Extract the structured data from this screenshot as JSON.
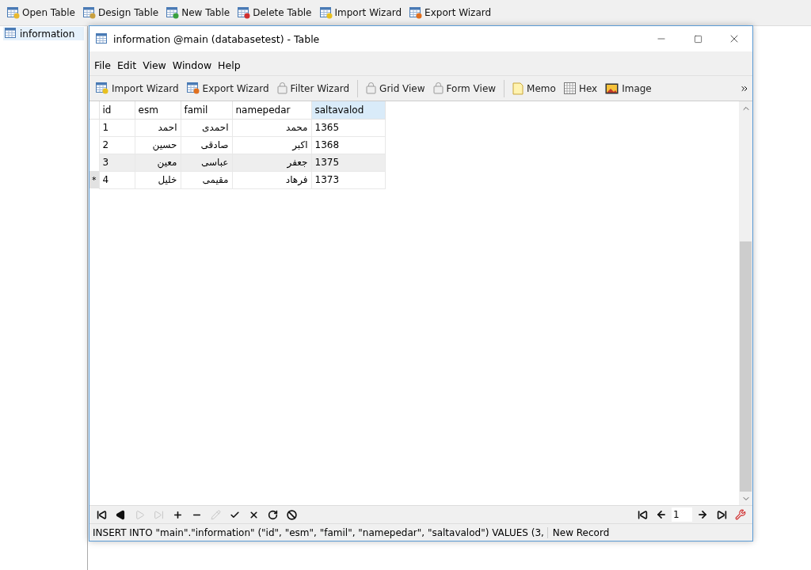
{
  "main_toolbar": [
    {
      "label": "Open Table",
      "kind": "open"
    },
    {
      "label": "Design Table",
      "kind": "design"
    },
    {
      "label": "New Table",
      "kind": "new"
    },
    {
      "label": "Delete Table",
      "kind": "delete"
    },
    {
      "label": "Import Wizard",
      "kind": "import"
    },
    {
      "label": "Export Wizard",
      "kind": "export"
    }
  ],
  "sidebar": {
    "items": [
      {
        "label": "information",
        "selected": true
      }
    ]
  },
  "window": {
    "title": "information @main (databasetest) - Table"
  },
  "menu": [
    "File",
    "Edit",
    "View",
    "Window",
    "Help"
  ],
  "toolbar": [
    {
      "label": "Import Wizard",
      "kind": "import",
      "disabled": false
    },
    {
      "label": "Export Wizard",
      "kind": "export",
      "disabled": false
    },
    {
      "label": "Filter Wizard",
      "kind": "lock",
      "disabled": false
    },
    {
      "kind": "separator"
    },
    {
      "label": "Grid View",
      "kind": "lock",
      "disabled": false
    },
    {
      "label": "Form View",
      "kind": "lock",
      "disabled": false
    },
    {
      "kind": "separator"
    },
    {
      "label": "Memo",
      "kind": "memo",
      "disabled": false
    },
    {
      "label": "Hex",
      "kind": "hex",
      "disabled": false
    },
    {
      "label": "Image",
      "kind": "image",
      "disabled": false
    }
  ],
  "table": {
    "columns": [
      {
        "label": "id",
        "selected": false
      },
      {
        "label": "esm",
        "selected": false
      },
      {
        "label": "famil",
        "selected": false
      },
      {
        "label": "namepedar",
        "selected": false
      },
      {
        "label": "saltavalod",
        "selected": true
      }
    ],
    "rows": [
      {
        "cells": [
          "1",
          "احمد",
          "احمدی",
          "محمد",
          "1365"
        ],
        "highlighted": false,
        "current": false
      },
      {
        "cells": [
          "2",
          "حسین",
          "صادقی",
          "اکبر",
          "1368"
        ],
        "highlighted": false,
        "current": false
      },
      {
        "cells": [
          "3",
          "معین",
          "عباسی",
          "جعفر",
          "1375"
        ],
        "highlighted": true,
        "current": false
      },
      {
        "cells": [
          "4",
          "خلیل",
          "مقیمی",
          "فرهاد",
          "1373"
        ],
        "highlighted": false,
        "current": true,
        "marker": "*"
      }
    ]
  },
  "nav_buttons": [
    {
      "kind": "first",
      "disabled": false
    },
    {
      "kind": "prev",
      "disabled": false
    },
    {
      "kind": "next",
      "disabled": true
    },
    {
      "kind": "last",
      "disabled": true
    },
    {
      "kind": "add",
      "disabled": false
    },
    {
      "kind": "remove",
      "disabled": false
    },
    {
      "kind": "edit",
      "disabled": true
    },
    {
      "kind": "apply",
      "disabled": false
    },
    {
      "kind": "cancel",
      "disabled": false
    },
    {
      "kind": "refresh",
      "disabled": false
    },
    {
      "kind": "stop",
      "disabled": false
    }
  ],
  "pager": {
    "page": "1"
  },
  "status_bar": {
    "sql": "INSERT INTO \"main\".\"information\" (\"id\", \"esm\", \"famil\", \"namepedar\", \"saltavalod\") VALUES (3,",
    "state": "New Record"
  }
}
